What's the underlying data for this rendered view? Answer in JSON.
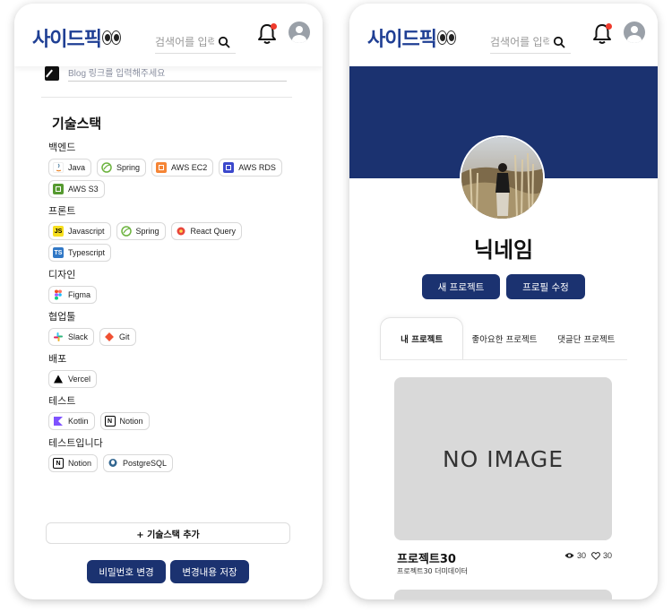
{
  "header": {
    "logo_text": "사이드픽",
    "search_placeholder": "검색어를 입력하세요"
  },
  "edit_page": {
    "blog_placeholder": "Blog 링크를 입력해주세요",
    "tech_title": "기술스택",
    "categories": [
      {
        "label": "백엔드",
        "chips": [
          {
            "name": "Java",
            "icon": "java-icon",
            "color": "#ffffff"
          },
          {
            "name": "Spring",
            "icon": "spring-icon",
            "color": "#6db33f"
          },
          {
            "name": "AWS EC2",
            "icon": "aws-ec2-icon",
            "color": "#f58536"
          },
          {
            "name": "AWS RDS",
            "icon": "aws-rds-icon",
            "color": "#3b48cc"
          },
          {
            "name": "AWS S3",
            "icon": "aws-s3-icon",
            "color": "#569a31"
          }
        ]
      },
      {
        "label": "프론트",
        "chips": [
          {
            "name": "Javascript",
            "icon": "javascript-icon",
            "color": "#f7df1e"
          },
          {
            "name": "Spring",
            "icon": "spring-icon",
            "color": "#6db33f"
          },
          {
            "name": "React Query",
            "icon": "react-query-icon",
            "color": "#e8453c"
          },
          {
            "name": "Typescript",
            "icon": "typescript-icon",
            "color": "#3178c6"
          }
        ]
      },
      {
        "label": "디자인",
        "chips": [
          {
            "name": "Figma",
            "icon": "figma-icon",
            "color": "#f24e1e"
          }
        ]
      },
      {
        "label": "협업툴",
        "chips": [
          {
            "name": "Slack",
            "icon": "slack-icon",
            "color": "#4a154b"
          },
          {
            "name": "Git",
            "icon": "git-icon",
            "color": "#f05032"
          }
        ]
      },
      {
        "label": "배포",
        "chips": [
          {
            "name": "Vercel",
            "icon": "vercel-icon",
            "color": "#000000"
          }
        ]
      },
      {
        "label": "테스트",
        "chips": [
          {
            "name": "Kotlin",
            "icon": "kotlin-icon",
            "color": "#7f52ff"
          },
          {
            "name": "Notion",
            "icon": "notion-icon",
            "color": "#000000"
          }
        ]
      },
      {
        "label": "테스트입니다",
        "chips": [
          {
            "name": "Notion",
            "icon": "notion-icon",
            "color": "#000000"
          },
          {
            "name": "PostgreSQL",
            "icon": "postgresql-icon",
            "color": "#336791"
          }
        ]
      }
    ],
    "add_tech_label": "+ 기술스택 추가",
    "change_password_label": "비밀번호 변경",
    "save_changes_label": "변경내용 저장"
  },
  "profile_page": {
    "nickname": "닉네임",
    "new_project_label": "새 프로젝트",
    "edit_profile_label": "프로필 수정",
    "tabs": [
      {
        "label": "내 프로젝트",
        "active": true
      },
      {
        "label": "좋아요한 프로젝트",
        "active": false
      },
      {
        "label": "댓글단 프로젝트",
        "active": false
      }
    ],
    "project": {
      "image_placeholder": "NO IMAGE",
      "title": "프로젝트30",
      "subtitle": "프로젝트30 더미데이터",
      "views": "30",
      "likes": "30"
    }
  },
  "colors": {
    "brand_navy": "#1b3270",
    "logo_blue": "#1f3f94",
    "notification_dot": "#ef3b2d"
  }
}
